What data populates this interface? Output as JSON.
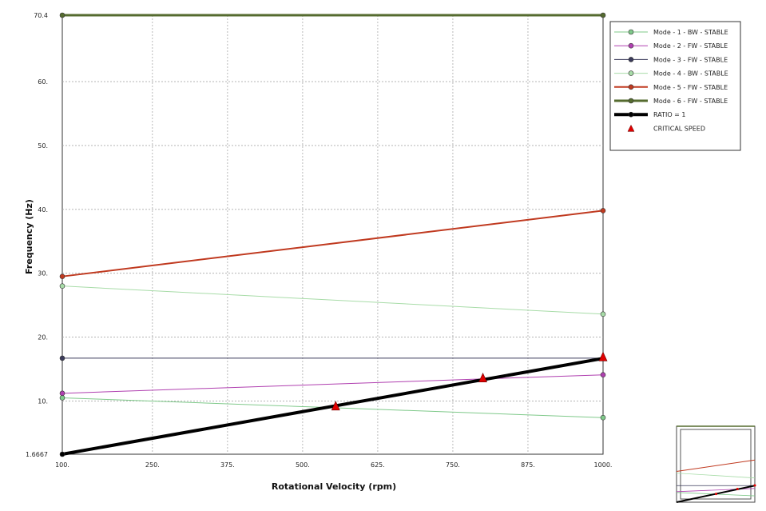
{
  "chart_data": {
    "type": "line",
    "xlabel": "Rotational Velocity (rpm)",
    "ylabel": "Frequency (Hz)",
    "xlim": [
      100,
      1000
    ],
    "ylim": [
      1.6667,
      70.4
    ],
    "x_ticks": [
      100,
      250,
      375,
      500,
      625,
      750,
      875,
      1000
    ],
    "x_tick_labels": [
      "100.",
      "250.",
      "375.",
      "500.",
      "625.",
      "750.",
      "875.",
      "1000."
    ],
    "y_ticks": [
      1.6667,
      10,
      20,
      30,
      40,
      50,
      60,
      70.4
    ],
    "y_tick_labels": [
      "1.6667",
      "10.",
      "20.",
      "30.",
      "40.",
      "50.",
      "60.",
      "70.4"
    ],
    "grid": true,
    "legend_position": "top-right",
    "series": [
      {
        "name": "Mode - 1  - BW  - STABLE",
        "x": [
          100,
          1000
        ],
        "y": [
          10.5,
          7.4
        ],
        "color": "#7fc98a",
        "width": 1
      },
      {
        "name": "Mode - 2  - FW  - STABLE",
        "x": [
          100,
          1000
        ],
        "y": [
          11.2,
          14.1
        ],
        "color": "#b040b0",
        "width": 1
      },
      {
        "name": "Mode - 3  - FW  - STABLE",
        "x": [
          100,
          1000
        ],
        "y": [
          16.7,
          16.7
        ],
        "color": "#3a3a5a",
        "width": 1
      },
      {
        "name": "Mode - 4  - BW  - STABLE",
        "x": [
          100,
          1000
        ],
        "y": [
          28.0,
          23.6
        ],
        "color": "#a8dca8",
        "width": 1
      },
      {
        "name": "Mode - 5  - FW  - STABLE",
        "x": [
          100,
          1000
        ],
        "y": [
          29.5,
          39.8
        ],
        "color": "#c03a20",
        "width": 2
      },
      {
        "name": "Mode - 6  - FW  - STABLE",
        "x": [
          100,
          1000
        ],
        "y": [
          70.4,
          70.4
        ],
        "color": "#556b2f",
        "width": 3
      },
      {
        "name": "RATIO = 1",
        "x": [
          100,
          1000
        ],
        "y": [
          1.6667,
          16.6667
        ],
        "color": "#000000",
        "width": 4
      }
    ],
    "critical_speed": {
      "name": "CRITICAL SPEED",
      "color": "#e00000",
      "x": [
        555,
        800,
        1000
      ],
      "y": [
        9.2,
        13.6,
        16.9
      ]
    }
  }
}
